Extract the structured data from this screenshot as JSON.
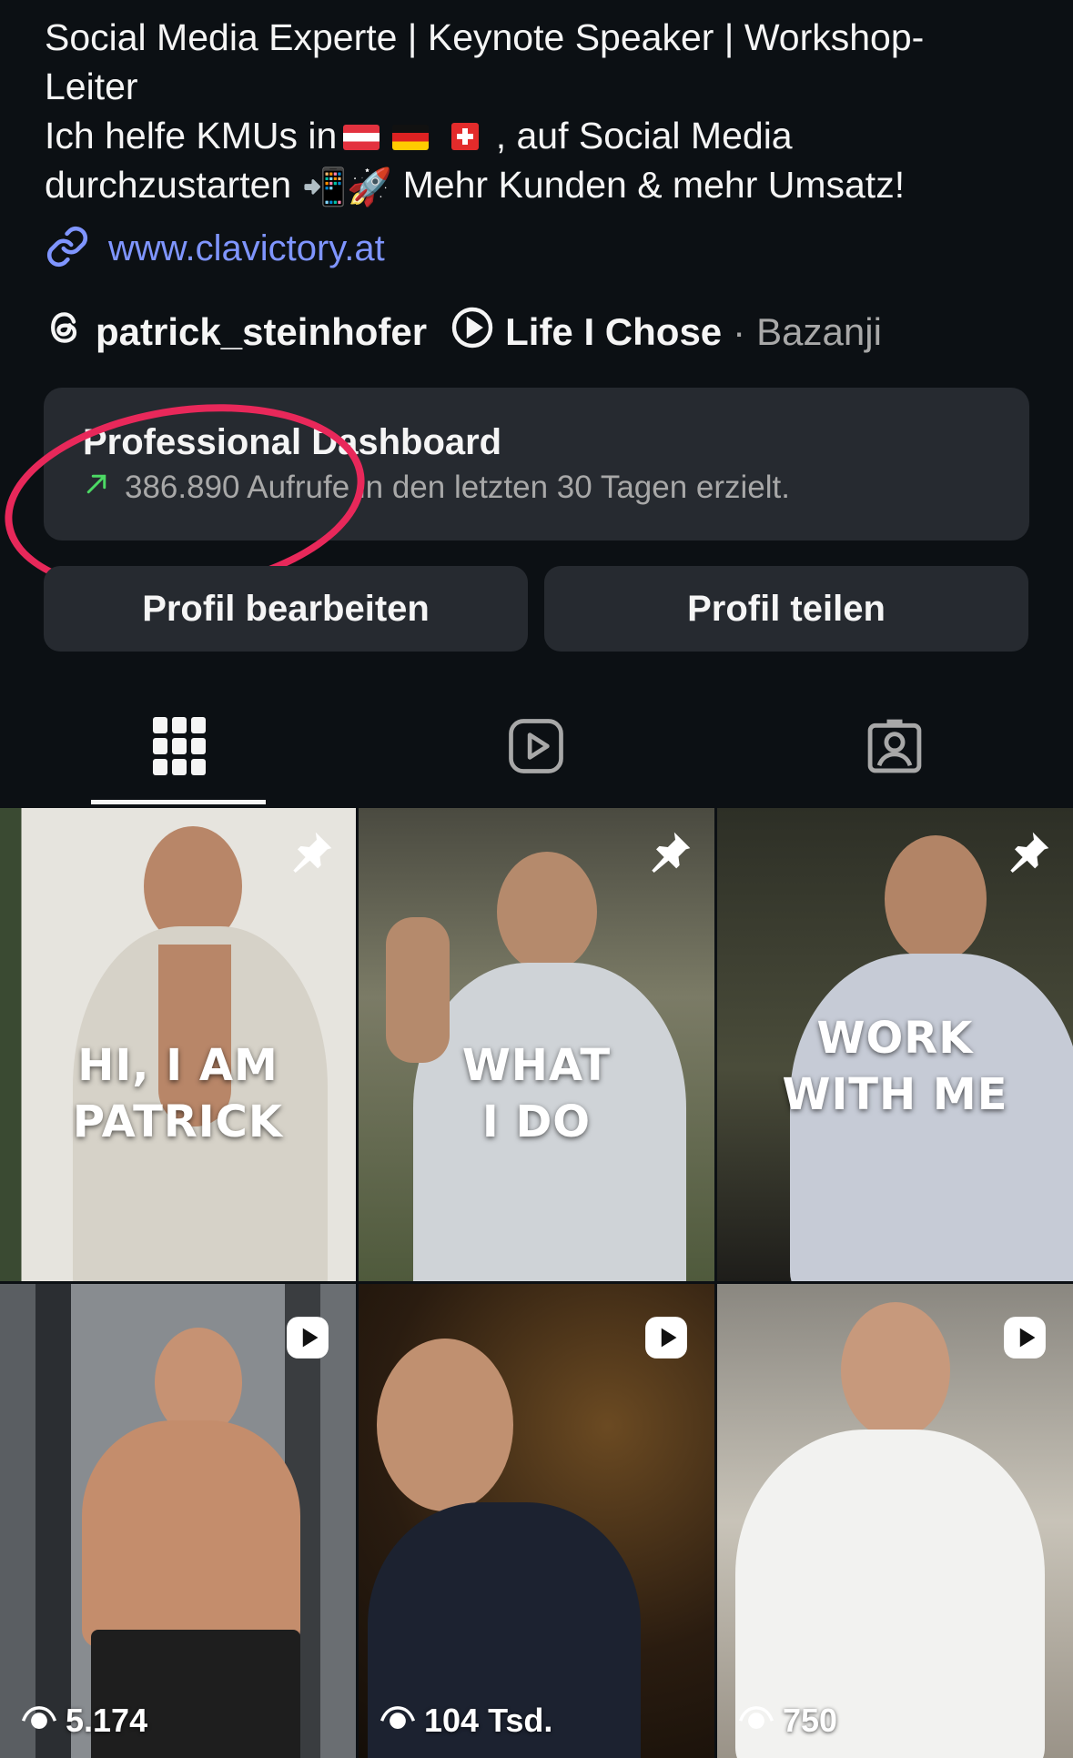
{
  "bio": {
    "line1": "Social Media Experte | Keynote Speaker | Workshop-",
    "line2": "Leiter",
    "line3_prefix": "Ich helfe KMUs in",
    "line3_suffix": ", auf Social Media",
    "line4_prefix": "durchzustarten",
    "line4_emoji": "📲🚀",
    "line4_suffix": "Mehr Kunden & mehr Umsatz!"
  },
  "link": {
    "text": "www.clavictory.at",
    "icon": "link-icon"
  },
  "meta": {
    "threads_handle": "patrick_steinhofer",
    "song_title": "Life I Chose",
    "separator": "·",
    "artist": "Bazanji"
  },
  "dashboard": {
    "title": "Professional Dashboard",
    "stat": "386.890 Aufrufe in den letzten 30 Tagen erzielt."
  },
  "buttons": {
    "edit": "Profil bearbeiten",
    "share": "Profil teilen"
  },
  "tabs": [
    {
      "name": "posts-grid",
      "icon": "grid-icon",
      "active": true
    },
    {
      "name": "reels",
      "icon": "reels-icon",
      "active": false
    },
    {
      "name": "tagged",
      "icon": "tagged-icon",
      "active": false
    }
  ],
  "posts": [
    {
      "overlay_line1": "HI, I AM",
      "overlay_line2": "PATRICK",
      "pinned": true
    },
    {
      "overlay_line1": "WHAT",
      "overlay_line2": "I DO",
      "pinned": true
    },
    {
      "overlay_line1": "WORK",
      "overlay_line2": "WITH ME",
      "pinned": true
    },
    {
      "views": "5.174",
      "reel": true
    },
    {
      "views": "104 Tsd.",
      "reel": true
    },
    {
      "views": "750",
      "reel": true
    }
  ],
  "colors": {
    "background": "#0c1014",
    "card": "#262a30",
    "link": "#7f95ff",
    "annotation": "#e8285a",
    "trend": "#4cd964"
  }
}
